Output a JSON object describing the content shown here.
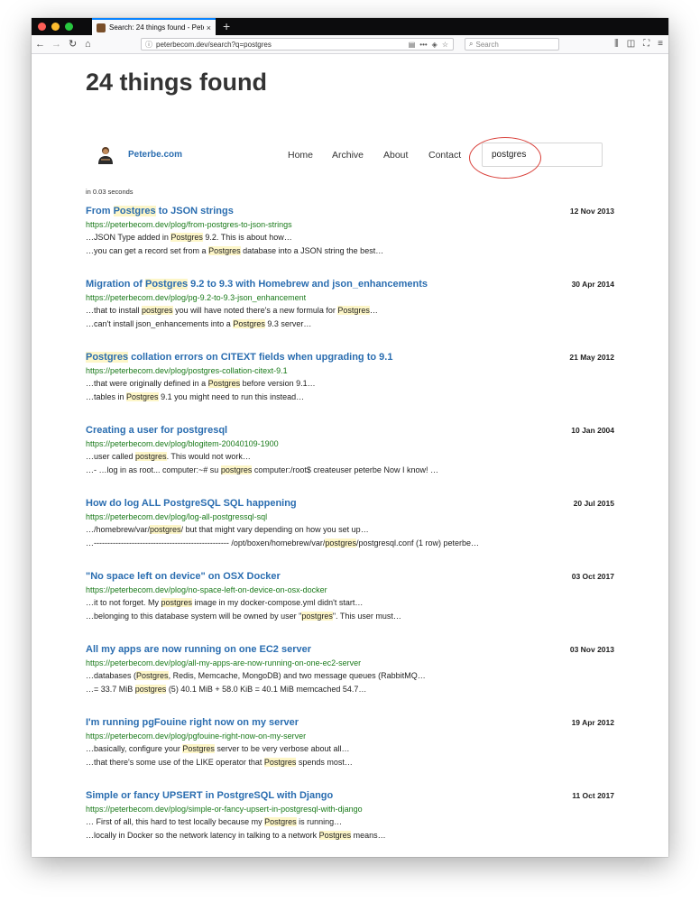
{
  "browser": {
    "tab_title": "Search: 24 things found - Pete",
    "tab_close": "×",
    "new_tab": "+",
    "url": "peterbecom.dev/search?q=postgres",
    "search_placeholder": "Search"
  },
  "page": {
    "heading": "24 things found",
    "brand": "Peterbe.com",
    "nav": [
      "Home",
      "Archive",
      "About",
      "Contact"
    ],
    "search_value": "postgres",
    "timing": "in 0.03 seconds"
  },
  "results": [
    {
      "title": [
        [
          "",
          "From "
        ],
        [
          "h",
          "Postgres"
        ],
        [
          "",
          " to JSON strings"
        ]
      ],
      "date": "12 Nov 2013",
      "url": "https://peterbecom.dev/plog/from-postgres-to-json-strings",
      "snippets": [
        [
          [
            "",
            "…JSON Type added in "
          ],
          [
            "h",
            "Postgres"
          ],
          [
            "",
            " 9.2. This is about how…"
          ]
        ],
        [
          [
            "",
            "…you can get a record set from a "
          ],
          [
            "h",
            "Postgres"
          ],
          [
            "",
            " database into a JSON string the best…"
          ]
        ]
      ]
    },
    {
      "title": [
        [
          "",
          "Migration of "
        ],
        [
          "h",
          "Postgres"
        ],
        [
          "",
          " 9.2 to 9.3 with Homebrew and json_enhancements"
        ]
      ],
      "date": "30 Apr 2014",
      "url": "https://peterbecom.dev/plog/pg-9.2-to-9.3-json_enhancement",
      "snippets": [
        [
          [
            "",
            "…that to install "
          ],
          [
            "h",
            "postgres"
          ],
          [
            "",
            " you will have noted there's a new formula for "
          ],
          [
            "h",
            "Postgres"
          ],
          [
            "",
            "…"
          ]
        ],
        [
          [
            "",
            "…can't install json_enhancements into a "
          ],
          [
            "h",
            "Postgres"
          ],
          [
            "",
            " 9.3 server…"
          ]
        ]
      ]
    },
    {
      "title": [
        [
          "h",
          "Postgres"
        ],
        [
          "",
          " collation errors on CITEXT fields when upgrading to 9.1"
        ]
      ],
      "date": "21 May 2012",
      "url": "https://peterbecom.dev/plog/postgres-collation-citext-9.1",
      "snippets": [
        [
          [
            "",
            "…that were originally defined in a "
          ],
          [
            "h",
            "Postgres"
          ],
          [
            "",
            " before version 9.1…"
          ]
        ],
        [
          [
            "",
            "…tables in "
          ],
          [
            "h",
            "Postgres"
          ],
          [
            "",
            " 9.1 you might need to run this instead…"
          ]
        ]
      ]
    },
    {
      "title": [
        [
          "",
          "Creating a user for postgresql"
        ]
      ],
      "date": "10 Jan 2004",
      "url": "https://peterbecom.dev/plog/blogitem-20040109-1900",
      "snippets": [
        [
          [
            "",
            "…user called "
          ],
          [
            "h",
            "postgres"
          ],
          [
            "",
            ". This would not work…"
          ]
        ],
        [
          [
            "",
            "…- …log in as root... computer:~# su "
          ],
          [
            "h",
            "postgres"
          ],
          [
            "",
            " computer:/root$ createuser peterbe Now I know! …"
          ]
        ]
      ]
    },
    {
      "title": [
        [
          "",
          "How do log ALL PostgreSQL SQL happening"
        ]
      ],
      "date": "20 Jul 2015",
      "url": "https://peterbecom.dev/plog/log-all-postgressql-sql",
      "snippets": [
        [
          [
            "",
            "…/homebrew/var/"
          ],
          [
            "h",
            "postgres"
          ],
          [
            "",
            "/ but that might vary depending on how you set up…"
          ]
        ],
        [
          [
            "",
            "…-------------------------------------------------- /opt/boxen/homebrew/var/"
          ],
          [
            "h",
            "postgres"
          ],
          [
            "",
            "/postgresql.conf (1 row) peterbe…"
          ]
        ]
      ]
    },
    {
      "title": [
        [
          "",
          "\"No space left on device\" on OSX Docker"
        ]
      ],
      "date": "03 Oct 2017",
      "url": "https://peterbecom.dev/plog/no-space-left-on-device-on-osx-docker",
      "snippets": [
        [
          [
            "",
            "…it to not forget. My "
          ],
          [
            "h",
            "postgres"
          ],
          [
            "",
            " image in my docker-compose.yml didn't start…"
          ]
        ],
        [
          [
            "",
            "…belonging to this database system will be owned by user \""
          ],
          [
            "h",
            "postgres"
          ],
          [
            "",
            "\". This user must…"
          ]
        ]
      ]
    },
    {
      "title": [
        [
          "",
          "All my apps are now running on one EC2 server"
        ]
      ],
      "date": "03 Nov 2013",
      "url": "https://peterbecom.dev/plog/all-my-apps-are-now-running-on-one-ec2-server",
      "snippets": [
        [
          [
            "",
            "…databases ("
          ],
          [
            "h",
            "Postgres"
          ],
          [
            "",
            ", Redis, Memcache, MongoDB) and two message queues (RabbitMQ…"
          ]
        ],
        [
          [
            "",
            "…= 33.7 MiB "
          ],
          [
            "h",
            "postgres"
          ],
          [
            "",
            " (5) 40.1 MiB + 58.0 KiB = 40.1 MiB memcached 54.7…"
          ]
        ]
      ]
    },
    {
      "title": [
        [
          "",
          "I'm running pgFouine right now on my server"
        ]
      ],
      "date": "19 Apr 2012",
      "url": "https://peterbecom.dev/plog/pgfouine-right-now-on-my-server",
      "snippets": [
        [
          [
            "",
            "…basically, configure your "
          ],
          [
            "h",
            "Postgres"
          ],
          [
            "",
            " server to be very verbose about all…"
          ]
        ],
        [
          [
            "",
            "…that there's some use of the LIKE operator that "
          ],
          [
            "h",
            "Postgres"
          ],
          [
            "",
            " spends most…"
          ]
        ]
      ]
    },
    {
      "title": [
        [
          "",
          "Simple or fancy UPSERT in PostgreSQL with Django"
        ]
      ],
      "date": "11 Oct 2017",
      "url": "https://peterbecom.dev/plog/simple-or-fancy-upsert-in-postgresql-with-django",
      "snippets": [
        [
          [
            "",
            "… First of all, this hard to test locally because my "
          ],
          [
            "h",
            "Postgres"
          ],
          [
            "",
            " is running…"
          ]
        ],
        [
          [
            "",
            "…locally in Docker so the network latency in talking to a network "
          ],
          [
            "h",
            "Postgres"
          ],
          [
            "",
            " means…"
          ]
        ]
      ]
    }
  ]
}
